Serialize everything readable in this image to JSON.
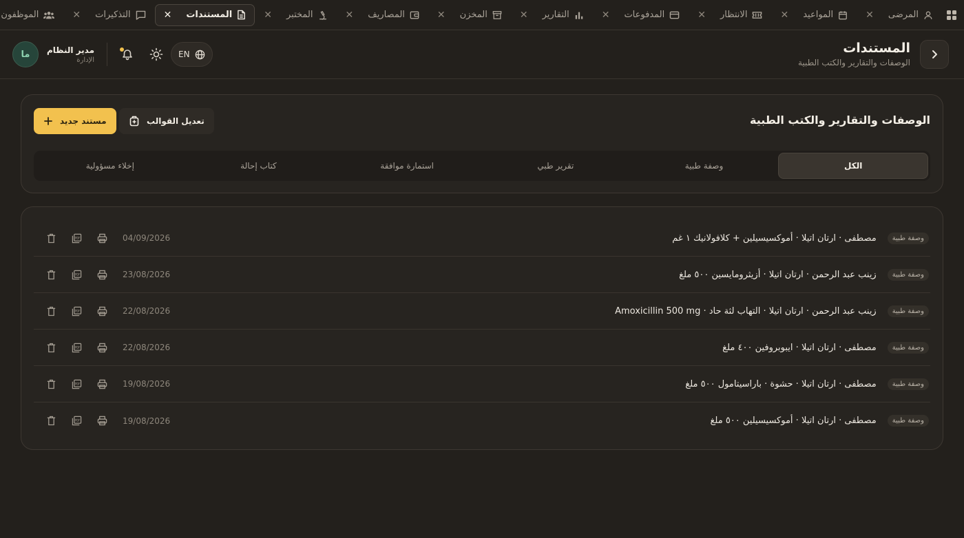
{
  "tabs": [
    {
      "label": "المرضى",
      "icon": "user-icon",
      "active": false
    },
    {
      "label": "المواعيد",
      "icon": "calendar-icon",
      "active": false
    },
    {
      "label": "الانتظار",
      "icon": "ticket-icon",
      "active": false
    },
    {
      "label": "المدفوعات",
      "icon": "credit-card-icon",
      "active": false
    },
    {
      "label": "التقارير",
      "icon": "bar-chart-icon",
      "active": false
    },
    {
      "label": "المخزن",
      "icon": "archive-icon",
      "active": false
    },
    {
      "label": "المصاريف",
      "icon": "wallet-icon",
      "active": false
    },
    {
      "label": "المختبر",
      "icon": "microscope-icon",
      "active": false
    },
    {
      "label": "المستندات",
      "icon": "document-icon",
      "active": true
    },
    {
      "label": "التذكيرات",
      "icon": "message-icon",
      "active": false
    },
    {
      "label": "الموظفون",
      "icon": "users-icon",
      "active": false
    }
  ],
  "header": {
    "title": "المستندات",
    "subtitle": "الوصفات والتقارير والكتب الطبية",
    "language": "EN",
    "user_name": "مدير النظام",
    "user_role": "الإدارة",
    "avatar_initials": "ما"
  },
  "section": {
    "title": "الوصفات والتقارير والكتب الطبية",
    "new_button": "مستند جديد",
    "templates_button": "تعديل القوالب"
  },
  "filters": [
    "الكل",
    "وصفة طبية",
    "تقرير طبي",
    "استمارة موافقة",
    "كتاب إحالة",
    "إخلاء مسؤولية"
  ],
  "documents": [
    {
      "type": "وصفة طبية",
      "text": "مصطفى · ارتان اتيلا · أموكسيسيلين + كلافولانيك ١ غم",
      "date": "04/09/2026"
    },
    {
      "type": "وصفة طبية",
      "text": "زينب عبد الرحمن · ارتان اتيلا · أزيثرومايسين ٥٠٠ ملغ",
      "date": "23/08/2026"
    },
    {
      "type": "وصفة طبية",
      "text": "زينب عبد الرحمن · ارتان اتيلا · التهاب لثة حاد · Amoxicillin 500 mg",
      "date": "22/08/2026"
    },
    {
      "type": "وصفة طبية",
      "text": "مصطفى · ارتان اتيلا · ايبوبروفين ٤٠٠ ملغ",
      "date": "22/08/2026"
    },
    {
      "type": "وصفة طبية",
      "text": "مصطفى · ارتان اتيلا · حشوة · باراسيتامول ٥٠٠ ملغ",
      "date": "19/08/2026"
    },
    {
      "type": "وصفة طبية",
      "text": "مصطفى · ارتان اتيلا · أموكسيسيلين ٥٠٠ ملغ",
      "date": "19/08/2026"
    }
  ],
  "colors": {
    "background": "#23201c",
    "card": "#272420",
    "accent": "#f2c14e",
    "avatar": "#26453a"
  }
}
